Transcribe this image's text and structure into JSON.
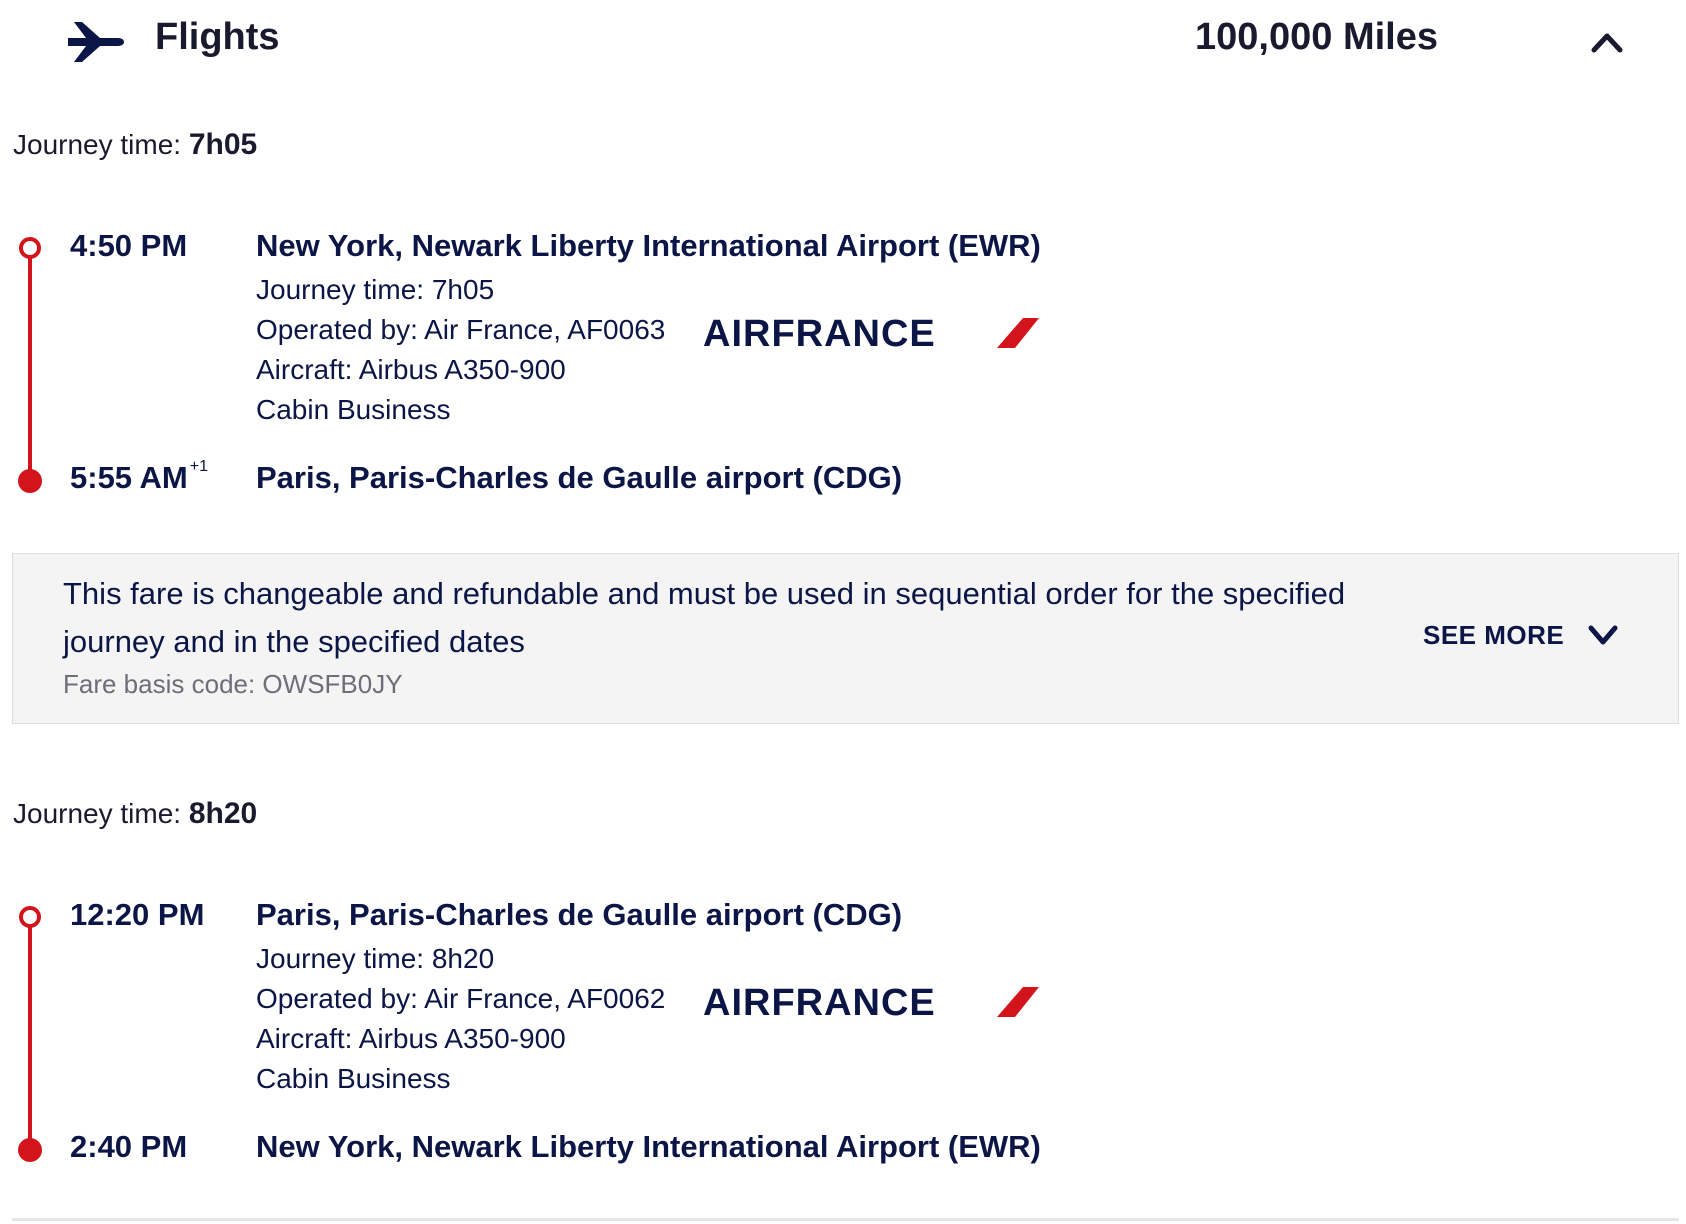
{
  "header": {
    "title": "Flights",
    "icon": "plane-icon",
    "miles": "100,000 Miles",
    "toggle_icon": "chevron-up-icon"
  },
  "segments": [
    {
      "journey_label": "Journey time: ",
      "journey_value": "7h05",
      "departure": {
        "time": "4:50 PM",
        "airport": "New York, Newark Liberty International Airport (EWR)"
      },
      "details": {
        "journey_time": "Journey time: 7h05",
        "operated_by": "Operated by: Air France, AF0063",
        "aircraft": "Aircraft: Airbus A350-900",
        "cabin": "Cabin Business"
      },
      "airline_logo": "AIRFRANCE",
      "arrival": {
        "time": "5:55 AM",
        "day_offset": "+1",
        "airport": "Paris, Paris-Charles de Gaulle airport (CDG)"
      }
    },
    {
      "journey_label": "Journey time: ",
      "journey_value": "8h20",
      "departure": {
        "time": "12:20 PM",
        "airport": "Paris, Paris-Charles de Gaulle airport (CDG)"
      },
      "details": {
        "journey_time": "Journey time: 8h20",
        "operated_by": "Operated by: Air France, AF0062",
        "aircraft": "Aircraft: Airbus A350-900",
        "cabin": "Cabin Business"
      },
      "airline_logo": "AIRFRANCE",
      "arrival": {
        "time": "2:40 PM",
        "day_offset": "",
        "airport": "New York, Newark Liberty International Airport (EWR)"
      }
    }
  ],
  "fare": {
    "description": "This fare is changeable and refundable and must be used in sequential order for the specified journey and in the specified dates",
    "basis_code": "Fare basis code: OWSFB0JY",
    "see_more": "SEE MORE",
    "toggle_icon": "chevron-down-icon"
  },
  "colors": {
    "navy": "#0b1546",
    "red": "#d4141b",
    "fare_bg": "#f4f4f4"
  }
}
